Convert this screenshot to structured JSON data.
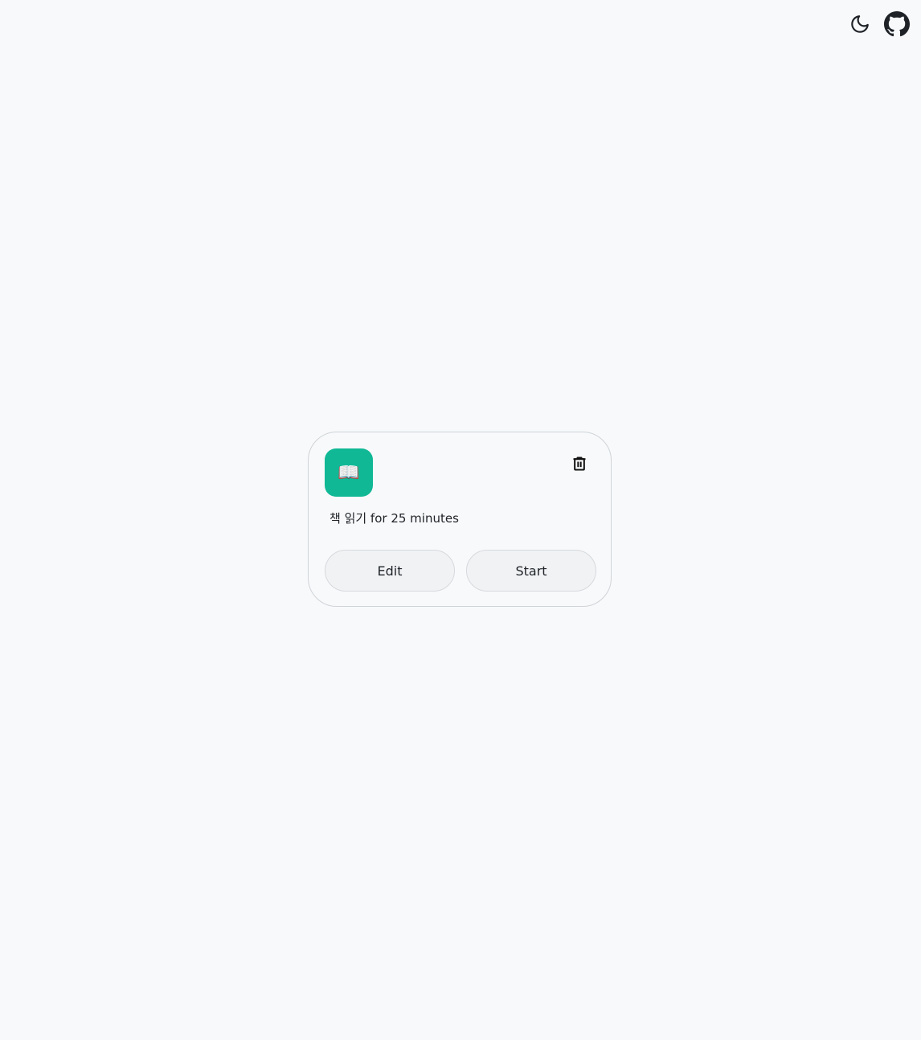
{
  "header": {
    "theme_toggle_icon": "moon-icon",
    "repo_link_icon": "github-icon"
  },
  "task_card": {
    "icon_emoji": "📖",
    "icon_name": "book-icon",
    "icon_color": "#10b896",
    "task_text": "책 읽기 for 25 minutes",
    "delete_icon": "trash-icon",
    "edit_label": "Edit",
    "start_label": "Start"
  }
}
